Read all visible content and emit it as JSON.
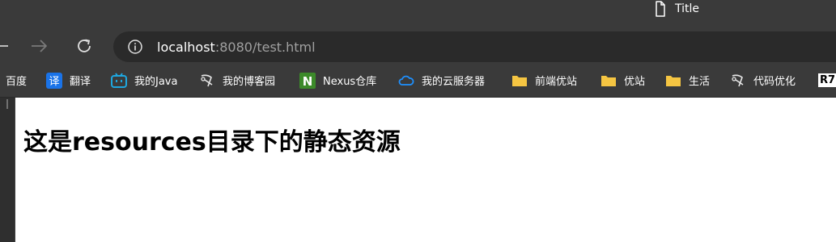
{
  "tab": {
    "title": "Title",
    "icon": "document-icon"
  },
  "toolbar": {
    "back_icon": "back-arrow-icon",
    "forward_icon": "forward-arrow-icon",
    "reload_icon": "reload-icon",
    "info_icon": "info-icon",
    "url_host": "localhost",
    "url_rest": ":8080/test.html"
  },
  "bookmarks": [
    {
      "label": "百度",
      "icon": ""
    },
    {
      "label": "翻译",
      "icon": "translate-icon"
    },
    {
      "label": "我的Java",
      "icon": "bilibili-icon"
    },
    {
      "label": "我的博客园",
      "icon": "cnblogs-icon"
    },
    {
      "label": "Nexus仓库",
      "icon": "nexus-icon"
    },
    {
      "label": "我的云服务器",
      "icon": "cloud-icon"
    },
    {
      "label": "前端优站",
      "icon": "folder-icon"
    },
    {
      "label": "优站",
      "icon": "folder-icon"
    },
    {
      "label": "生活",
      "icon": "folder-icon"
    },
    {
      "label": "代码优化",
      "icon": "cnblogs-icon"
    },
    {
      "label": "R7",
      "icon": ""
    }
  ],
  "page": {
    "heading": "这是resources目录下的静态资源"
  },
  "colors": {
    "chrome": "#3a3a3a",
    "address_bar": "#2a2a2a",
    "folder": "#f5c542",
    "translate": "#1a73e8",
    "nexus": "#3c8a2a",
    "cloud": "#1e90ff"
  }
}
